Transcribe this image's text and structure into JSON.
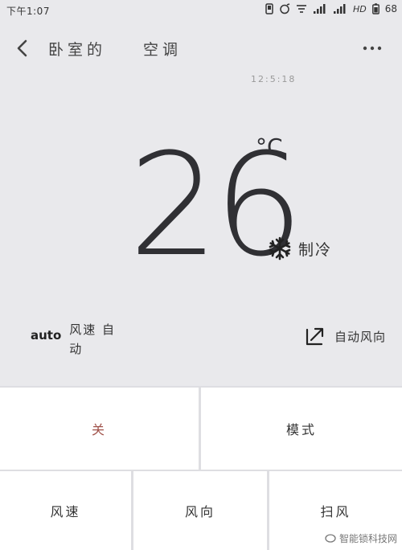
{
  "status_bar": {
    "time": "下午1:07",
    "network": "HD",
    "battery": "68"
  },
  "header": {
    "device_name": "卧室的",
    "device_type": "空调",
    "icons": [
      "back-icon",
      "more-icon"
    ]
  },
  "sync_time": "12:5:18",
  "climate": {
    "temperature": "26",
    "unit": "°C",
    "mode": "制冷",
    "mode_icon": "snowflake-icon"
  },
  "fan_status": {
    "auto_tag": "auto",
    "label": "风速 自动"
  },
  "direction_status": {
    "label": "自动风向",
    "icon": "swing-arrow-icon"
  },
  "controls": {
    "power": "关",
    "mode": "模式",
    "fan": "风速",
    "direction": "风向",
    "swing": "扫风"
  },
  "watermark": "智能锁科技网",
  "colors": {
    "background": "#e9e9ec",
    "panel": "#ffffff",
    "text": "#303034",
    "power_accent": "#a0524a"
  }
}
